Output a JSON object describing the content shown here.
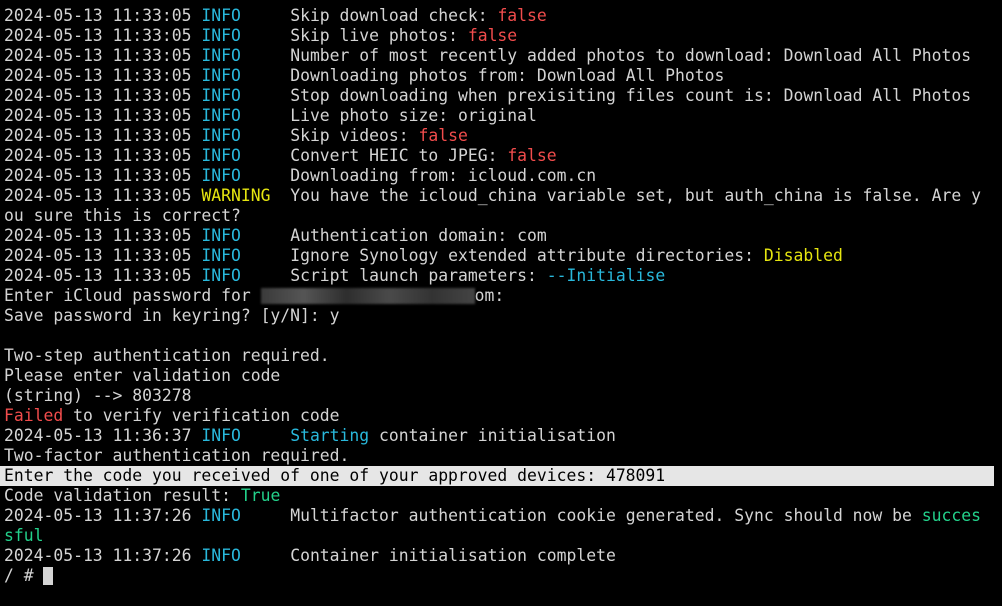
{
  "lines": [
    {
      "ts": "2024-05-13 11:33:05",
      "lvl": "INFO   ",
      "text": "Skip download check: ",
      "val": "false"
    },
    {
      "ts": "2024-05-13 11:33:05",
      "lvl": "INFO   ",
      "text": "Skip live photos: ",
      "val": "false"
    },
    {
      "ts": "2024-05-13 11:33:05",
      "lvl": "INFO   ",
      "text": "Number of most recently added photos to download: Download All Photos"
    },
    {
      "ts": "2024-05-13 11:33:05",
      "lvl": "INFO   ",
      "text": "Downloading photos from: Download All Photos"
    },
    {
      "ts": "2024-05-13 11:33:05",
      "lvl": "INFO   ",
      "text": "Stop downloading when prexisiting files count is: Download All Photos"
    },
    {
      "ts": "2024-05-13 11:33:05",
      "lvl": "INFO   ",
      "text": "Live photo size: original"
    },
    {
      "ts": "2024-05-13 11:33:05",
      "lvl": "INFO   ",
      "text": "Skip videos: ",
      "val": "false"
    },
    {
      "ts": "2024-05-13 11:33:05",
      "lvl": "INFO   ",
      "text": "Convert HEIC to JPEG: ",
      "val": "false"
    },
    {
      "ts": "2024-05-13 11:33:05",
      "lvl": "INFO   ",
      "text": "Downloading from: icloud.com.cn"
    },
    {
      "ts": "2024-05-13 11:33:05",
      "lvl": "WARNING",
      "text": "You have the icloud_china variable set, but auth_china is false. Are y"
    },
    {
      "plain": "ou sure this is correct?"
    },
    {
      "ts": "2024-05-13 11:33:05",
      "lvl": "INFO   ",
      "text": "Authentication domain: com"
    },
    {
      "ts": "2024-05-13 11:33:05",
      "lvl": "INFO   ",
      "text": "Ignore Synology extended attribute directories: ",
      "val": "Disabled"
    },
    {
      "ts": "2024-05-13 11:33:05",
      "lvl": "INFO   ",
      "text": "Script launch parameters: ",
      "val": "--Initialise"
    }
  ],
  "password_prompt": {
    "before": "Enter iCloud password for ",
    "after": "om:"
  },
  "keyring_prompt": "Save password in keyring? [y/N]: y",
  "two_step_required": "Two-step authentication required.",
  "enter_validation": "Please enter validation code",
  "string_prompt": "(string) --> 803278",
  "failed_word": "Failed",
  "failed_rest": " to verify verification code",
  "init_line": {
    "ts": "2024-05-13 11:36:37",
    "lvl": "INFO   ",
    "word": "Starting",
    "rest": " container initialisation"
  },
  "two_factor_required": "Two-factor authentication required.",
  "enter_code_line": "Enter the code you received of one of your approved devices: 478091",
  "validation_result": {
    "label": "Code validation result: ",
    "value": "True"
  },
  "mfa_line": {
    "ts": "2024-05-13 11:37:26",
    "lvl": "INFO   ",
    "text": "Multifactor authentication cookie generated. Sync should now be ",
    "val": "succes"
  },
  "mfa_wrap": "sful",
  "complete_line": {
    "ts": "2024-05-13 11:37:26",
    "lvl": "INFO   ",
    "text": "Container initialisation complete"
  },
  "prompt": "/ # "
}
